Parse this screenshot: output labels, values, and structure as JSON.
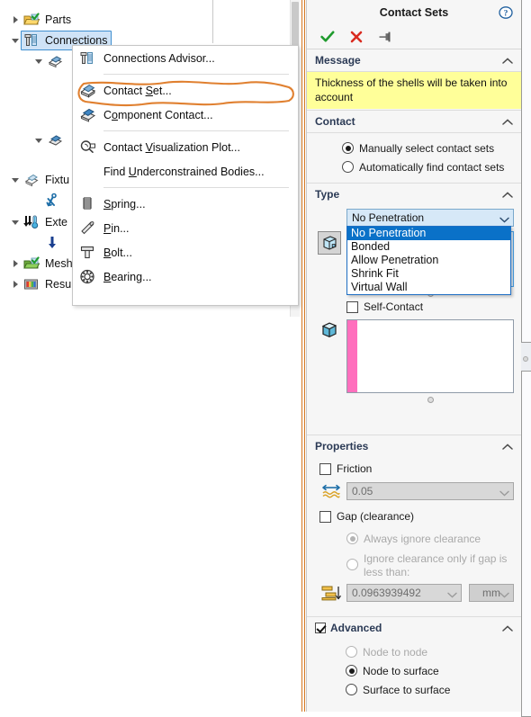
{
  "tree": {
    "items": [
      {
        "label": "Parts",
        "icon": "parts-folder-icon",
        "state": "collapsed",
        "selected": false
      },
      {
        "label": "Connections",
        "icon": "connections-icon",
        "state": "expanded",
        "selected": true
      },
      {
        "label": "",
        "icon": "contact-set-icon",
        "state": "expanded",
        "selected": false
      },
      {
        "label": "",
        "icon": "component-contact-icon",
        "state": "expanded",
        "selected": false
      },
      {
        "label": "Fixtu",
        "icon": "fixtures-icon",
        "state": "expanded",
        "selected": false
      },
      {
        "label": "",
        "icon": "fixture-anchor-icon",
        "state": "none",
        "selected": false
      },
      {
        "label": "Exte",
        "icon": "external-loads-icon",
        "state": "expanded",
        "selected": false
      },
      {
        "label": "",
        "icon": "force-arrow-icon",
        "state": "none",
        "selected": false
      },
      {
        "label": "Mesh",
        "icon": "mesh-icon",
        "state": "collapsed",
        "selected": false
      },
      {
        "label": "Resu",
        "icon": "results-icon",
        "state": "collapsed",
        "selected": false
      }
    ]
  },
  "context_menu": {
    "items": [
      {
        "type": "item",
        "label": "Connections Advisor...",
        "icon": "connections-advisor-icon",
        "mnemonic": "C",
        "highlighted": false
      },
      {
        "type": "separator"
      },
      {
        "type": "item",
        "label": "Contact Set...",
        "icon": "contact-set-icon",
        "mnemonic": "S",
        "highlighted": true
      },
      {
        "type": "item",
        "label": "Component Contact...",
        "icon": "component-contact-icon",
        "mnemonic": "o",
        "highlighted": false
      },
      {
        "type": "separator"
      },
      {
        "type": "item",
        "label": "Contact Visualization Plot...",
        "icon": "contact-visualization-icon",
        "mnemonic": "V",
        "highlighted": false
      },
      {
        "type": "item",
        "label": "Find Underconstrained Bodies...",
        "icon": "none",
        "mnemonic": "U",
        "highlighted": false
      },
      {
        "type": "separator"
      },
      {
        "type": "item",
        "label": "Spring...",
        "icon": "spring-icon",
        "mnemonic": "S",
        "highlighted": false
      },
      {
        "type": "item",
        "label": "Pin...",
        "icon": "pin-icon",
        "mnemonic": "P",
        "highlighted": false
      },
      {
        "type": "item",
        "label": "Bolt...",
        "icon": "bolt-icon",
        "mnemonic": "B",
        "highlighted": false
      },
      {
        "type": "item",
        "label": "Bearing...",
        "icon": "bearing-icon",
        "mnemonic": "B",
        "highlighted": false
      }
    ]
  },
  "property_manager": {
    "title": "Contact Sets",
    "toolbar": {
      "ok_label": "OK",
      "cancel_label": "Cancel",
      "pin_label": "Keep Visible",
      "help_label": "Help"
    },
    "message_section": {
      "title": "Message",
      "text": "Thickness of the shells will be taken into account",
      "background": "#ffff99",
      "expanded": true
    },
    "contact_section": {
      "title": "Contact",
      "expanded": true,
      "options": [
        {
          "label": "Manually select contact sets",
          "selected": true
        },
        {
          "label": "Automatically find contact sets",
          "selected": false
        }
      ]
    },
    "type_section": {
      "title": "Type",
      "expanded": true,
      "combo_value": "No Penetration",
      "dropdown_open": true,
      "dropdown_options": [
        {
          "label": "No Penetration",
          "selected": true
        },
        {
          "label": "Bonded",
          "selected": false
        },
        {
          "label": "Allow Penetration",
          "selected": false
        },
        {
          "label": "Shrink Fit",
          "selected": false
        },
        {
          "label": "Virtual Wall",
          "selected": false
        }
      ],
      "set1_box_value": "",
      "set1_color": "#1d9bf0",
      "self_contact": {
        "label": "Self-Contact",
        "checked": false
      },
      "set2_box_value": "",
      "set2_color": "#ff6fbd"
    },
    "properties_section": {
      "title": "Properties",
      "expanded": true,
      "friction": {
        "label": "Friction",
        "checked": false
      },
      "friction_value": "0.05",
      "gap": {
        "label": "Gap (clearance)",
        "checked": false
      },
      "gap_options": [
        {
          "label": "Always ignore clearance",
          "selected": true,
          "disabled": true
        },
        {
          "label": "Ignore clearance only if gap is less than:",
          "selected": false,
          "disabled": true
        }
      ],
      "gap_value": "0.0963939492",
      "gap_unit": "mm"
    },
    "advanced_section": {
      "title": "Advanced",
      "checked": true,
      "expanded": true,
      "options": [
        {
          "label": "Node to node",
          "selected": false,
          "disabled": true
        },
        {
          "label": "Node to surface",
          "selected": true,
          "disabled": false
        },
        {
          "label": "Surface to surface",
          "selected": false,
          "disabled": false
        }
      ]
    }
  },
  "colors": {
    "accent_orange": "#d4761f",
    "highlight_blue": "#0a71c8",
    "message_yellow": "#ffff99",
    "section_heading": "#2b3a55"
  }
}
